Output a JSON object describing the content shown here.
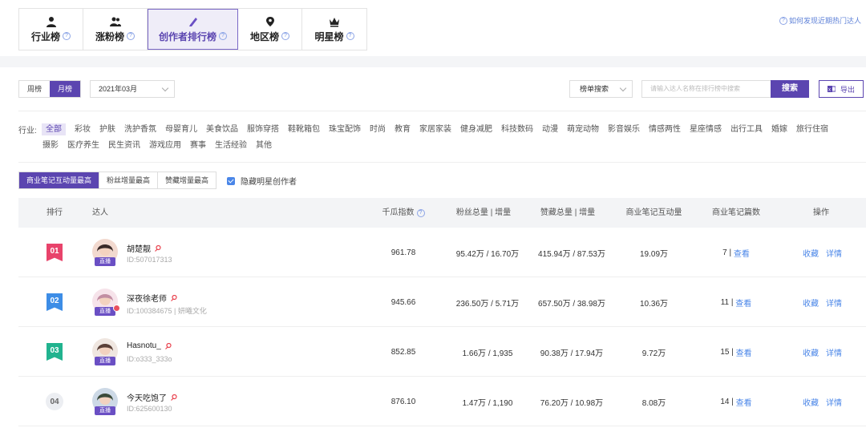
{
  "top_tabs": [
    {
      "label": "行业榜",
      "icon": "person-icon",
      "active": false
    },
    {
      "label": "涨粉榜",
      "icon": "group-icon",
      "active": false
    },
    {
      "label": "创作者排行榜",
      "icon": "pen-icon",
      "active": true
    },
    {
      "label": "地区榜",
      "icon": "location-icon",
      "active": false
    },
    {
      "label": "明星榜",
      "icon": "crown-icon",
      "active": false
    }
  ],
  "help_link": "如何发现近期热门达人",
  "period_toggle": {
    "weekly": "周榜",
    "monthly": "月榜"
  },
  "month_select": "2021年03月",
  "sort_select": "榜单搜索",
  "search": {
    "placeholder": "请输入达人名称在排行榜中搜索",
    "button": "搜索"
  },
  "export_label": "导出",
  "industry": {
    "label": "行业:",
    "chips": [
      "全部",
      "彩妆",
      "护肤",
      "洗护香氛",
      "母婴育儿",
      "美食饮品",
      "服饰穿搭",
      "鞋靴箱包",
      "珠宝配饰",
      "时尚",
      "教育",
      "家居家装",
      "健身减肥",
      "科技数码",
      "动漫",
      "萌宠动物",
      "影音娱乐",
      "情感两性",
      "星座情感",
      "出行工具",
      "婚嫁",
      "旅行住宿",
      "摄影",
      "医疗养生",
      "民生资讯",
      "游戏应用",
      "赛事",
      "生活经验",
      "其他"
    ]
  },
  "metric_tabs": [
    "商业笔记互动量最高",
    "粉丝增量最高",
    "赞藏增量最高"
  ],
  "hide_star_label": "隐藏明星创作者",
  "table": {
    "headers": {
      "rank": "排行",
      "talent": "达人",
      "index": "千瓜指数",
      "fans": "粉丝总量 | 增量",
      "likes": "赞藏总量 | 增量",
      "interaction": "商业笔记互动量",
      "notes": "商业笔记篇数",
      "ops": "操作"
    },
    "live_tag": "直播",
    "view_label": "查看",
    "collect_label": "收藏",
    "detail_label": "详情",
    "rows": [
      {
        "rank": "01",
        "name": "胡楚靓",
        "uid": "ID:507017313",
        "index": "961.78",
        "fans": "95.42万 / 16.70万",
        "likes": "415.94万 / 87.53万",
        "interaction": "19.09万",
        "notes": "7 |",
        "rank_color": "#e8436b"
      },
      {
        "rank": "02",
        "name": "深夜徐老师",
        "uid": "ID:100384675 | 妍曦文化",
        "index": "945.66",
        "fans": "236.50万 / 5.71万",
        "likes": "657.50万 / 38.98万",
        "interaction": "10.36万",
        "notes": "11 |",
        "rank_color": "#3d8de6"
      },
      {
        "rank": "03",
        "name": "Hasnotu_",
        "uid": "ID:o333_333o",
        "index": "852.85",
        "fans": "1.66万 / 1,935",
        "likes": "90.38万 / 17.94万",
        "interaction": "9.72万",
        "notes": "15 |",
        "rank_color": "#21b38f"
      },
      {
        "rank": "04",
        "name": "今天吃饱了",
        "uid": "ID:625600130",
        "index": "876.10",
        "fans": "1.47万 / 1,190",
        "likes": "76.20万 / 10.98万",
        "interaction": "8.08万",
        "notes": "14 |",
        "rank_color": ""
      }
    ]
  }
}
